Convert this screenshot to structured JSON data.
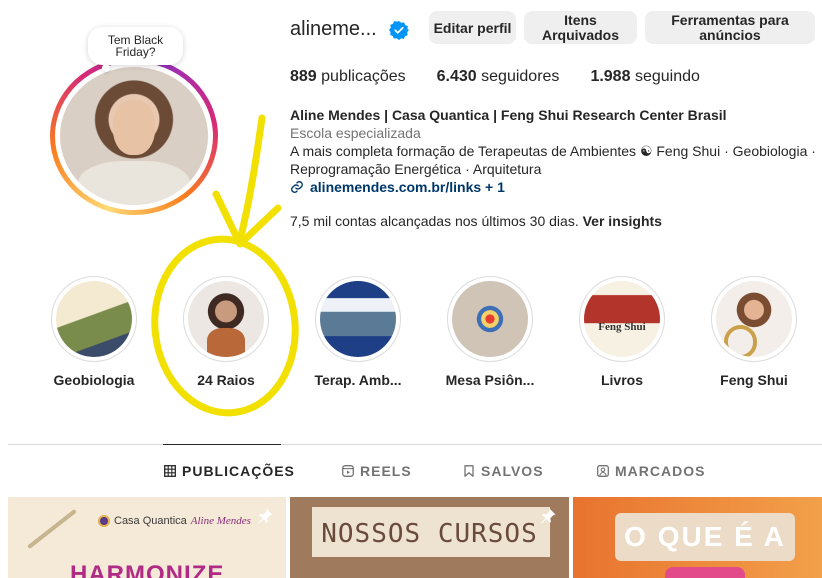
{
  "profile": {
    "username": "alineme...",
    "note": "Tem Black Friday?",
    "buttons": {
      "edit": "Editar perfil",
      "archive": "Itens Arquivados",
      "ad_tools": "Ferramentas para anúncios"
    },
    "stats": {
      "posts_count": "889",
      "posts_label": "publicações",
      "followers_count": "6.430",
      "followers_label": "seguidores",
      "following_count": "1.988",
      "following_label": "seguindo"
    },
    "bio": {
      "name": "Aline Mendes | Casa Quantica | Feng Shui Research Center Brasil",
      "category": "Escola especializada",
      "line1": "A mais completa formação de Terapeutas de Ambientes ☯ Feng Shui · Geobiologia ·",
      "line2": "Reprogramação Energética · Arquitetura",
      "link": "alinemendes.com.br/links + 1"
    },
    "insights": {
      "text": "7,5 mil contas alcançadas nos últimos 30 dias.",
      "action": "Ver insights"
    }
  },
  "highlights": [
    {
      "label": "Geobiologia"
    },
    {
      "label": "24 Raios"
    },
    {
      "label": "Terap. Amb..."
    },
    {
      "label": "Mesa Psiôn..."
    },
    {
      "label": "Livros"
    },
    {
      "label": "Feng Shui"
    }
  ],
  "tabs": [
    {
      "label": "PUBLICAÇÕES",
      "icon": "grid-icon",
      "active": true
    },
    {
      "label": "REELS",
      "icon": "reels-icon",
      "active": false
    },
    {
      "label": "SALVOS",
      "icon": "bookmark-icon",
      "active": false
    },
    {
      "label": "MARCADOS",
      "icon": "tagged-icon",
      "active": false
    }
  ],
  "posts": [
    {
      "brand": "Casa Quantica",
      "brand_script": "Aline Mendes",
      "headline": "HARMONIZE",
      "pinned": true
    },
    {
      "headline": "NOSSOS CURSOS",
      "pinned": true
    },
    {
      "headline": "O QUE É A",
      "pinned": false
    }
  ],
  "colors": {
    "annotation": "#f2e000",
    "link": "#00376b",
    "verified": "#0095f6",
    "button_bg": "#efefef"
  }
}
